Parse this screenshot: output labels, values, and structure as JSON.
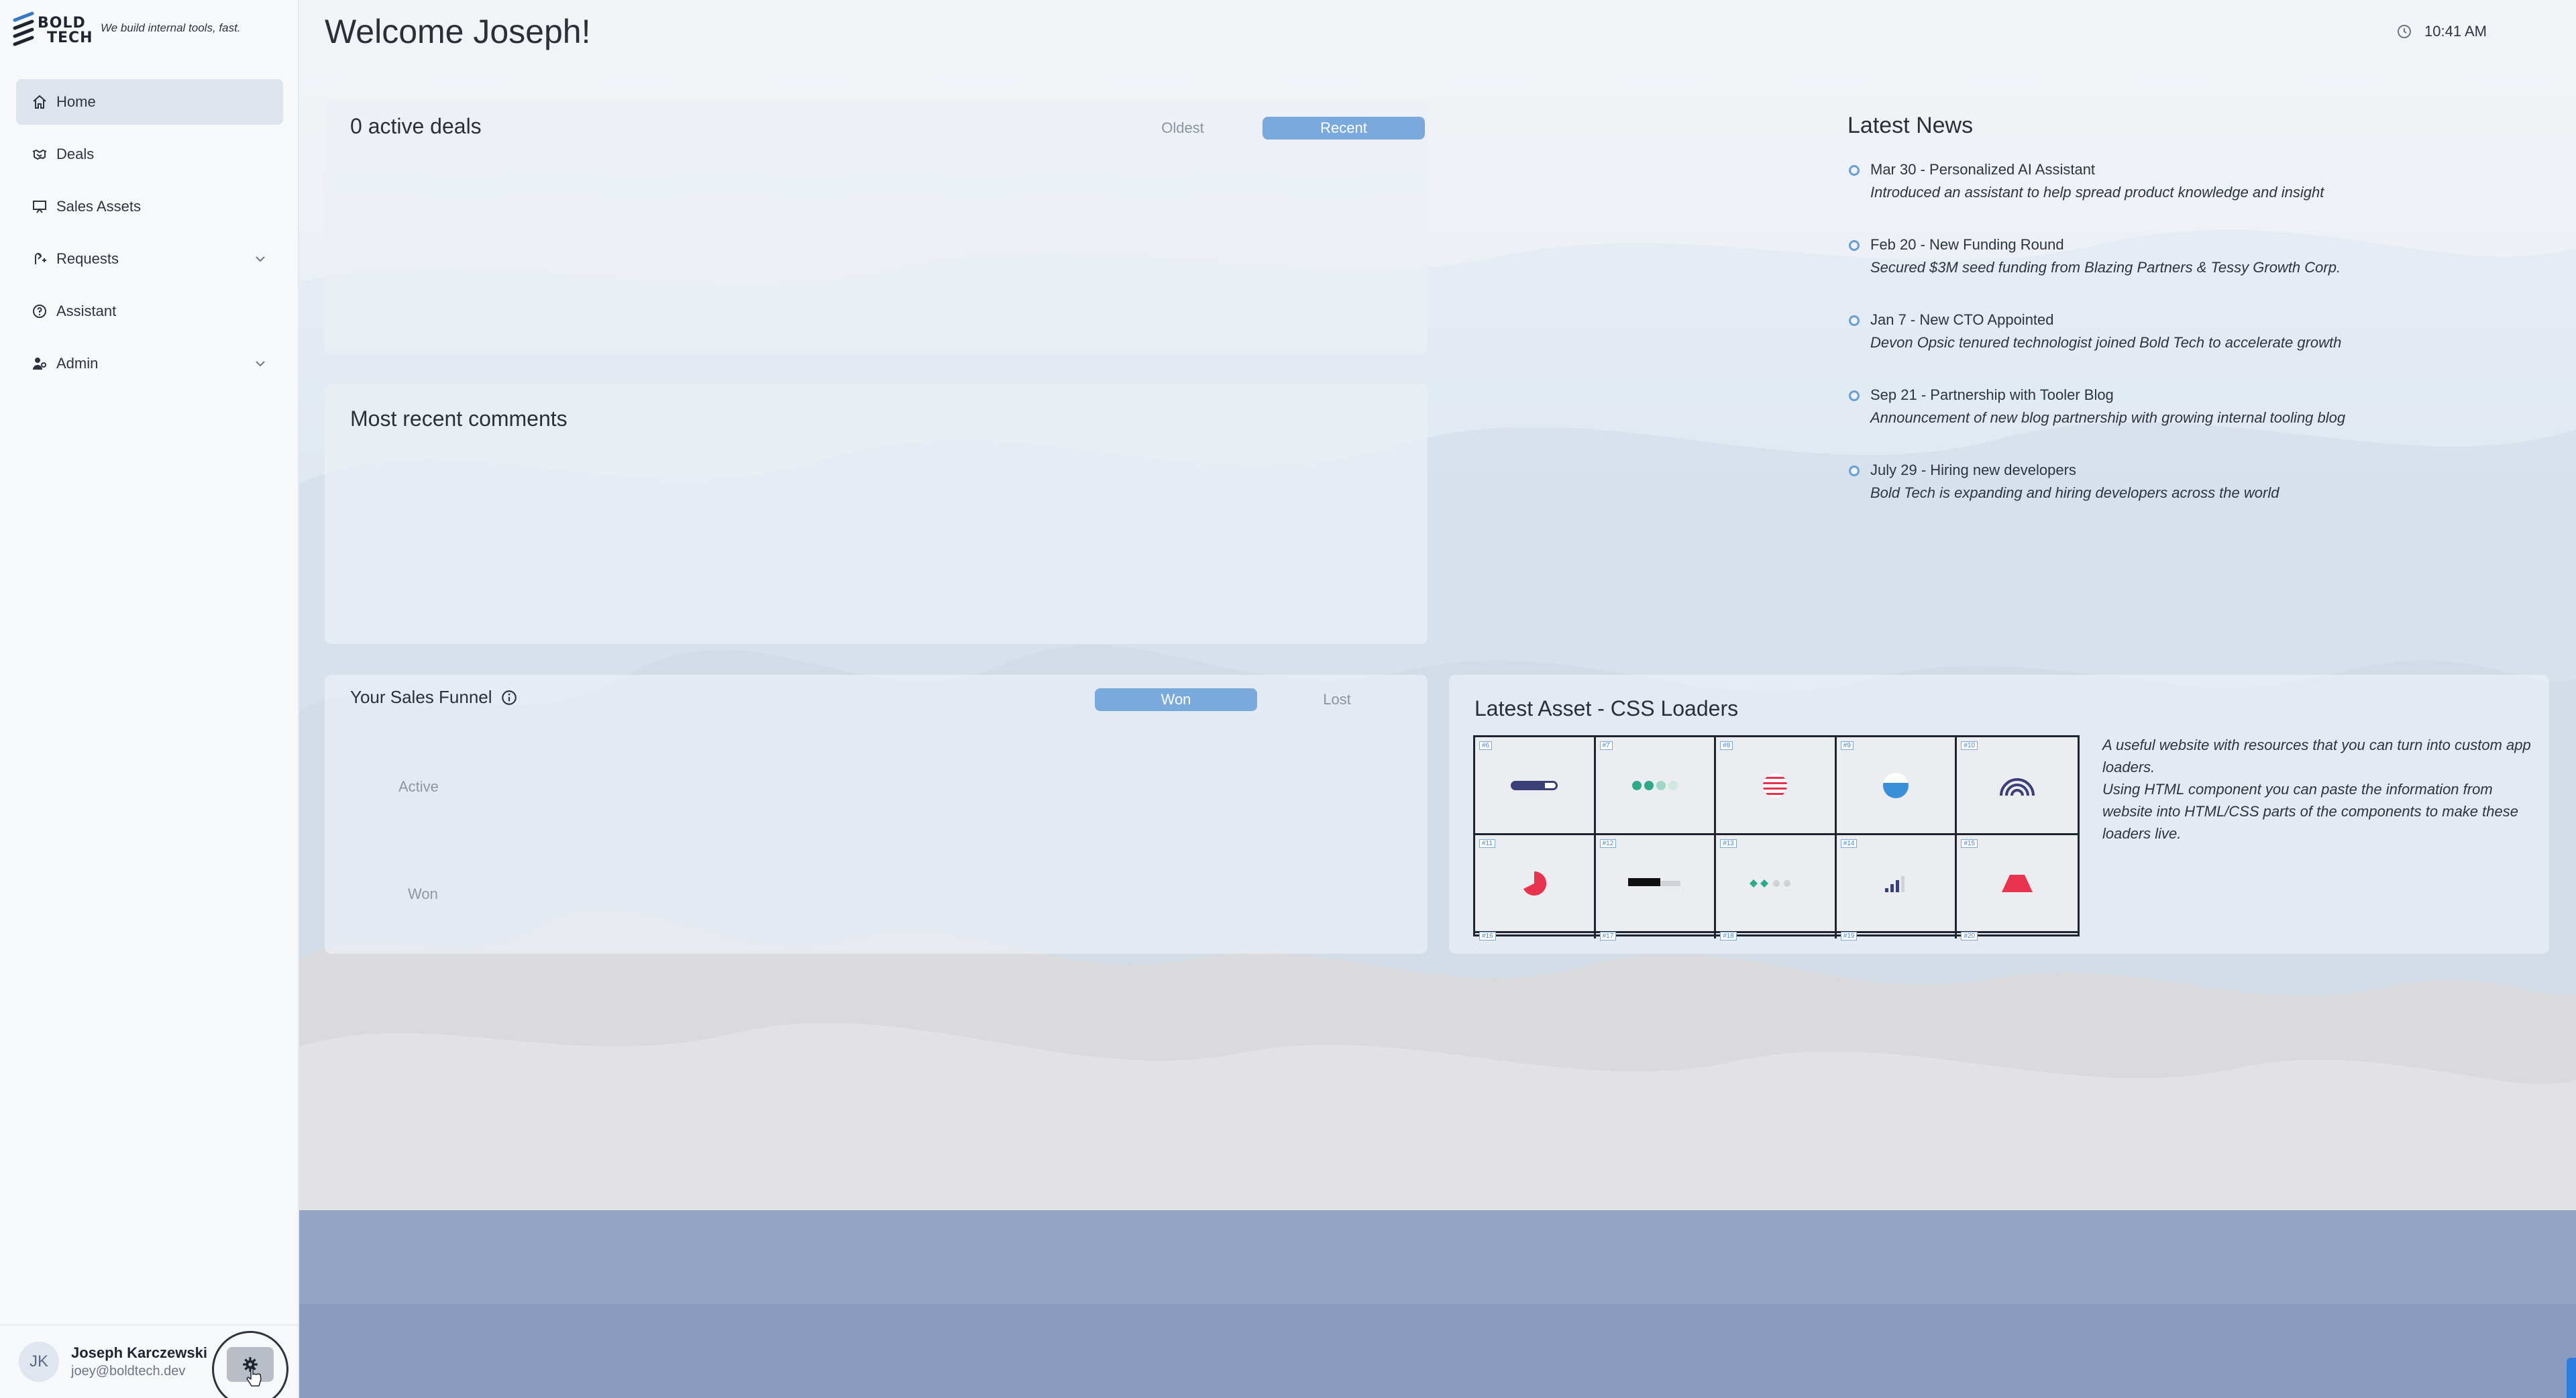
{
  "brand": {
    "logo_text_1": "BOLD",
    "logo_text_2": "TECH",
    "tagline": "We build internal tools, fast."
  },
  "sidebar": {
    "items": [
      {
        "label": "Home",
        "icon": "home-icon",
        "active": true
      },
      {
        "label": "Deals",
        "icon": "handshake-icon"
      },
      {
        "label": "Sales Assets",
        "icon": "presentation-icon"
      },
      {
        "label": "Requests",
        "icon": "request-icon",
        "expandable": true
      },
      {
        "label": "Assistant",
        "icon": "help-circle-icon"
      },
      {
        "label": "Admin",
        "icon": "users-icon",
        "expandable": true
      }
    ]
  },
  "user": {
    "initials": "JK",
    "name": "Joseph Karczewski",
    "email": "joey@boldtech.dev"
  },
  "header": {
    "title": "Welcome Joseph!",
    "time": "10:41 AM"
  },
  "deals": {
    "title": "0 active deals",
    "toggle_oldest": "Oldest",
    "toggle_recent": "Recent",
    "selected": "Recent"
  },
  "comments": {
    "title": "Most recent comments"
  },
  "funnel": {
    "title": "Your Sales Funnel",
    "toggle_won": "Won",
    "toggle_lost": "Lost",
    "selected": "Won",
    "labels": [
      "Active",
      "Won"
    ]
  },
  "news": {
    "title": "Latest News",
    "items": [
      {
        "headline": "Mar 30 - Personalized AI Assistant",
        "description": "Introduced an assistant to help spread product knowledge and insight"
      },
      {
        "headline": "Feb 20 - New Funding Round",
        "description": "Secured $3M seed funding from Blazing Partners & Tessy Growth Corp."
      },
      {
        "headline": "Jan 7 - New CTO Appointed",
        "description": "Devon Opsic tenured technologist joined Bold Tech to accelerate growth"
      },
      {
        "headline": "Sep 21 - Partnership with Tooler Blog",
        "description": "Announcement of new blog partnership with growing internal tooling blog"
      },
      {
        "headline": "July 29 - Hiring new developers",
        "description": "Bold Tech is expanding and hiring developers across the world"
      }
    ]
  },
  "asset": {
    "title": "Latest Asset - CSS Loaders",
    "description_1": "A useful website with resources that you can turn into custom app loaders.",
    "description_2": "Using HTML component you can paste the information from website into HTML/CSS parts of the components to make these loaders live.",
    "tags": [
      "#6",
      "#7",
      "#8",
      "#9",
      "#10",
      "#11",
      "#12",
      "#13",
      "#14",
      "#15",
      "#16",
      "#17",
      "#18",
      "#19",
      "#20"
    ]
  },
  "colors": {
    "accent": "#7aaadc",
    "active_nav": "#dde4ec",
    "loader_red": "#e8334f",
    "loader_green": "#2eaa8a",
    "loader_blue": "#3b8ed8",
    "loader_navy": "#3a3f78"
  }
}
